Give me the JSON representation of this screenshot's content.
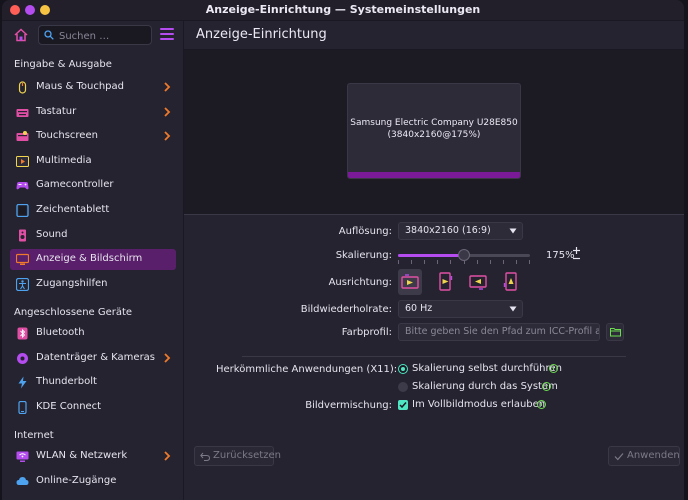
{
  "window": {
    "title": "Anzeige-Einrichtung — Systemeinstellungen"
  },
  "search": {
    "placeholder": "Suchen …"
  },
  "sidebar": {
    "sections": [
      "Eingabe & Ausgabe",
      "Angeschlossene Geräte",
      "Internet"
    ],
    "items": [
      {
        "label": "Maus & Touchpad",
        "icon": "mouse-icon"
      },
      {
        "label": "Tastatur",
        "icon": "keyboard-icon"
      },
      {
        "label": "Touchscreen",
        "icon": "touchscreen-icon"
      },
      {
        "label": "Multimedia",
        "icon": "multimedia-icon"
      },
      {
        "label": "Gamecontroller",
        "icon": "gamepad-icon"
      },
      {
        "label": "Zeichentablett",
        "icon": "tablet-icon"
      },
      {
        "label": "Sound",
        "icon": "speaker-icon"
      },
      {
        "label": "Anzeige & Bildschirm",
        "icon": "display-icon",
        "selected": true
      },
      {
        "label": "Zugangshilfen",
        "icon": "accessibility-icon"
      },
      {
        "label": "Bluetooth",
        "icon": "bluetooth-icon"
      },
      {
        "label": "Datenträger & Kameras",
        "icon": "drive-icon"
      },
      {
        "label": "Thunderbolt",
        "icon": "thunderbolt-icon"
      },
      {
        "label": "KDE Connect",
        "icon": "kdeconnect-icon"
      },
      {
        "label": "WLAN & Netzwerk",
        "icon": "wifi-icon"
      },
      {
        "label": "Online-Zugänge",
        "icon": "online-accounts-icon"
      }
    ]
  },
  "main": {
    "title": "Anzeige-Einrichtung",
    "monitor": {
      "name": "Samsung Electric Company U28E850",
      "mode": "(3840x2160@175%)"
    },
    "resolution": {
      "label": "Auflösung:",
      "value": "3840x2160 (16:9)"
    },
    "scale": {
      "label": "Skalierung:",
      "value": "175%",
      "fraction": 0.5
    },
    "orientation": {
      "label": "Ausrichtung:"
    },
    "refresh": {
      "label": "Bildwiederholrate:",
      "value": "60 Hz"
    },
    "color_profile": {
      "label": "Farbprofil:",
      "placeholder": "Bitte geben Sie den Pfad zum ICC-Profil an …"
    },
    "legacy": {
      "label": "Herkömmliche Anwendungen (X11):",
      "option1": "Skalierung selbst durchführen",
      "option2": "Skalierung durch das System"
    },
    "tearing": {
      "label": "Bildvermischung:",
      "option": "Im Vollbildmodus erlauben"
    },
    "buttons": {
      "reset": "Zurücksetzen",
      "apply": "Anwenden"
    }
  },
  "colors": {
    "accent": "#b44cf0",
    "selected_bg": "#5a1f6a",
    "check": "#4ee6c3",
    "info": "#6bdc4f",
    "orange": "#f07a2a"
  }
}
